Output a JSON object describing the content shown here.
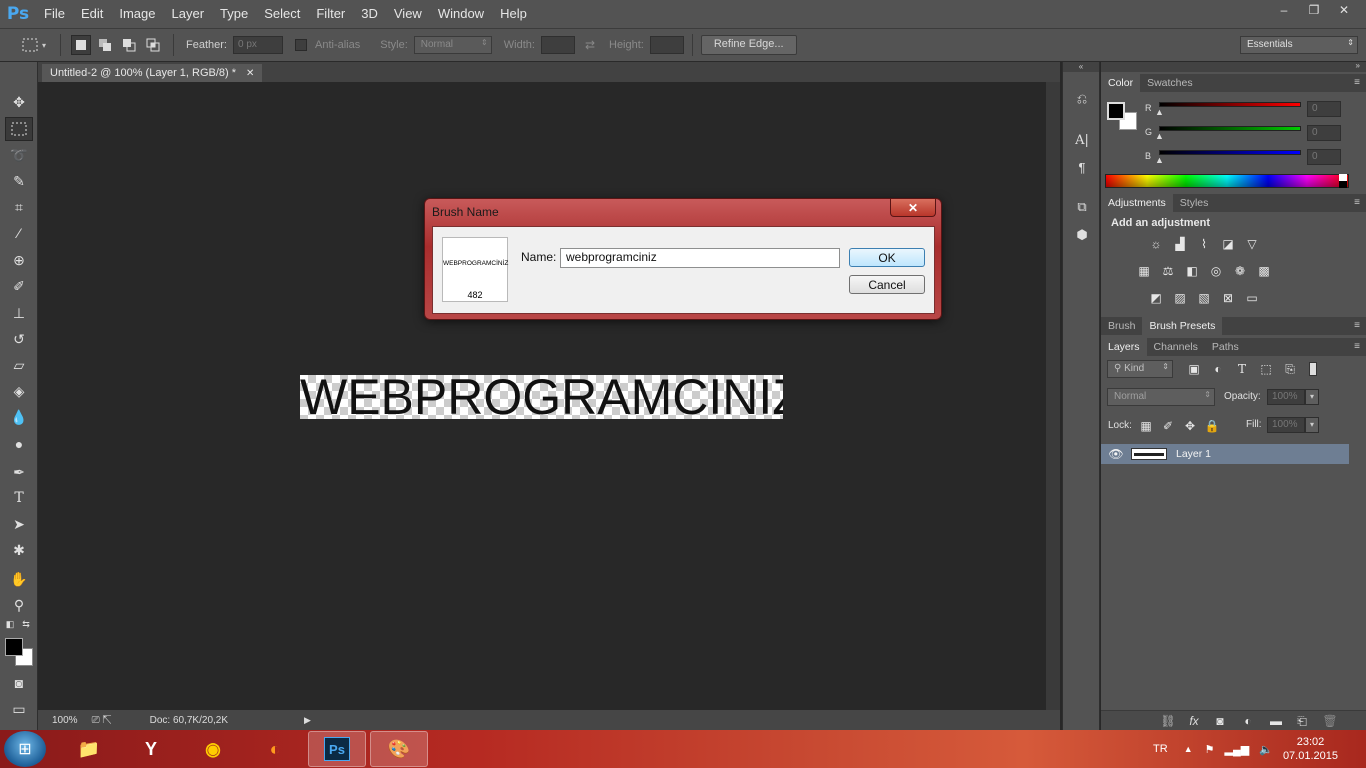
{
  "app": {
    "logo": "Ps"
  },
  "menubar": {
    "items": [
      "File",
      "Edit",
      "Image",
      "Layer",
      "Type",
      "Select",
      "Filter",
      "3D",
      "View",
      "Window",
      "Help"
    ]
  },
  "window_controls": {
    "minimize": "–",
    "restore": "❐",
    "close": "✕"
  },
  "options": {
    "feather_label": "Feather:",
    "feather_value": "0 px",
    "antialias_label": "Anti-alias",
    "style_label": "Style:",
    "style_value": "Normal",
    "width_label": "Width:",
    "height_label": "Height:",
    "refine_edge": "Refine Edge...",
    "workspace": "Essentials"
  },
  "document": {
    "tab_title": "Untitled-2 @ 100% (Layer 1, RGB/8) *",
    "canvas_text": "WEBPROGRAMCİNİZ"
  },
  "status": {
    "zoom": "100%",
    "doc_info": "Doc: 60,7K/20,2K"
  },
  "color_panel": {
    "tabs": [
      "Color",
      "Swatches"
    ],
    "channels": [
      {
        "label": "R",
        "value": "0",
        "color": "#ff0000"
      },
      {
        "label": "G",
        "value": "0",
        "color": "#00cc00"
      },
      {
        "label": "B",
        "value": "0",
        "color": "#0000ff"
      }
    ]
  },
  "adjustments_panel": {
    "tabs": [
      "Adjustments",
      "Styles"
    ],
    "heading": "Add an adjustment"
  },
  "brush_panel": {
    "tabs": [
      "Brush",
      "Brush Presets"
    ]
  },
  "layers_panel": {
    "tabs": [
      "Layers",
      "Channels",
      "Paths"
    ],
    "filter_kind": "Kind",
    "blend_mode": "Normal",
    "opacity_label": "Opacity:",
    "opacity_value": "100%",
    "lock_label": "Lock:",
    "fill_label": "Fill:",
    "fill_value": "100%",
    "layers": [
      {
        "name": "Layer 1",
        "visible": true,
        "selected": true
      }
    ]
  },
  "dialog": {
    "title": "Brush Name",
    "preview_text": "WEBPROGRAMCİNİZ",
    "brush_size": "482",
    "name_label": "Name:",
    "name_value": "webprogramciniz",
    "ok": "OK",
    "cancel": "Cancel",
    "close": "✕"
  },
  "taskbar": {
    "apps": [
      "explorer",
      "yandex",
      "chrome",
      "firefox",
      "photoshop",
      "paint"
    ],
    "photoshop_label": "Ps",
    "language": "TR",
    "time": "23:02",
    "date": "07.01.2015"
  },
  "colors": {
    "ui_bg": "#535353",
    "canvas_bg": "#282828",
    "dialog_frame": "#a82d2d",
    "layer_selected": "#6e7e93"
  }
}
